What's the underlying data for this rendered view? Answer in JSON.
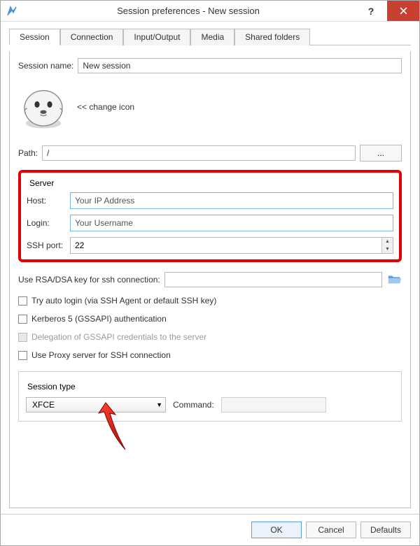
{
  "titlebar": {
    "title": "Session preferences - New session"
  },
  "tabs": [
    "Session",
    "Connection",
    "Input/Output",
    "Media",
    "Shared folders"
  ],
  "session_name": {
    "label": "Session name:",
    "value": "New session"
  },
  "change_icon": "<< change icon",
  "path": {
    "label": "Path:",
    "value": "/",
    "browse": "..."
  },
  "server": {
    "legend": "Server",
    "host_label": "Host:",
    "host": "Your IP Address",
    "login_label": "Login:",
    "login": "Your Username",
    "port_label": "SSH port:",
    "port": "22"
  },
  "rsa_label": "Use RSA/DSA key for ssh connection:",
  "chk_autologin": "Try auto login (via SSH Agent or default SSH key)",
  "chk_kerberos": "Kerberos 5 (GSSAPI) authentication",
  "chk_delegation": "Delegation of GSSAPI credentials to the server",
  "chk_proxy": "Use Proxy server for SSH connection",
  "session_type": {
    "legend": "Session type",
    "value": "XFCE",
    "command_label": "Command:"
  },
  "buttons": {
    "ok": "OK",
    "cancel": "Cancel",
    "defaults": "Defaults"
  }
}
